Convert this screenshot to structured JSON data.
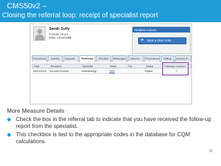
{
  "slide": {
    "title_line1": "CMS50v2 –",
    "title_line2": "Closing the referral loop: receipt of specialist report",
    "section_title": "More Measure Details",
    "bullets": [
      "Check the box in the referral tab to indicate that you have received the follow-up report from the specialist.",
      "This checkbox is tied to the appropriate codes in the database for CQM calculations."
    ],
    "page_number": "36",
    "colors": {
      "banner": "#1f9bd7",
      "highlight": "#7a2a99",
      "bullet": "#1f9bd7"
    }
  },
  "ehr": {
    "patient": {
      "name": "Sarah Sully",
      "gender_age": "Female, 25 yrs",
      "dob": "DOB: 12/16/1988"
    },
    "actions": {
      "header": "Related Actions",
      "chart_note_button": "Start a chart note"
    },
    "tabs": [
      "Facesheet",
      "Activity",
      "Appoint...",
      "Referrals",
      "eScripts",
      "Messages",
      "Labs/Im...",
      "Procedures",
      "Billing",
      "Access R..."
    ],
    "active_tab_index": 3,
    "table": {
      "headers": [
        "Date",
        "Recipient",
        "Specialty",
        "Notes",
        "Fax",
        "Status",
        "Followup received"
      ],
      "rows": [
        [
          "05/01/2014",
          "Ka-chuk Kovacs",
          "Dermatology",
          "View",
          "",
          "Digital",
          "✓"
        ]
      ]
    }
  }
}
